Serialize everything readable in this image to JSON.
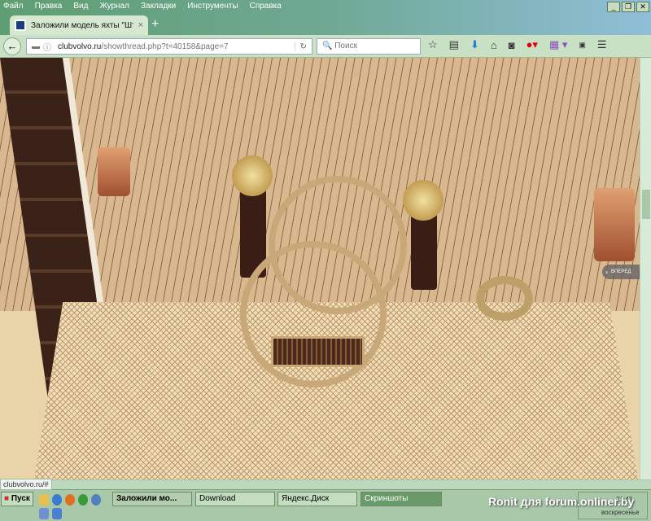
{
  "menu": [
    "Файл",
    "Правка",
    "Вид",
    "Журнал",
    "Закладки",
    "Инструменты",
    "Справка"
  ],
  "tab": {
    "title": "Заложили модель яхты \"Шт...",
    "close": "×",
    "new": "+"
  },
  "url": {
    "host": "clubvolvo.ru",
    "path": "/showthread.php?t=40158&page=7"
  },
  "search": {
    "placeholder": "Поиск"
  },
  "page": {
    "forward_label": "ВПЕРЕД"
  },
  "status_link": "clubvolvo.ru/#",
  "taskbar": {
    "start": "Пуск",
    "tasks": [
      "Заложили мо...",
      "Download",
      "Яндекс.Диск",
      "Скриншоты"
    ],
    "time": "21:43",
    "day": "воскресенье"
  },
  "watermark": "Ronit для forum.onliner.by"
}
